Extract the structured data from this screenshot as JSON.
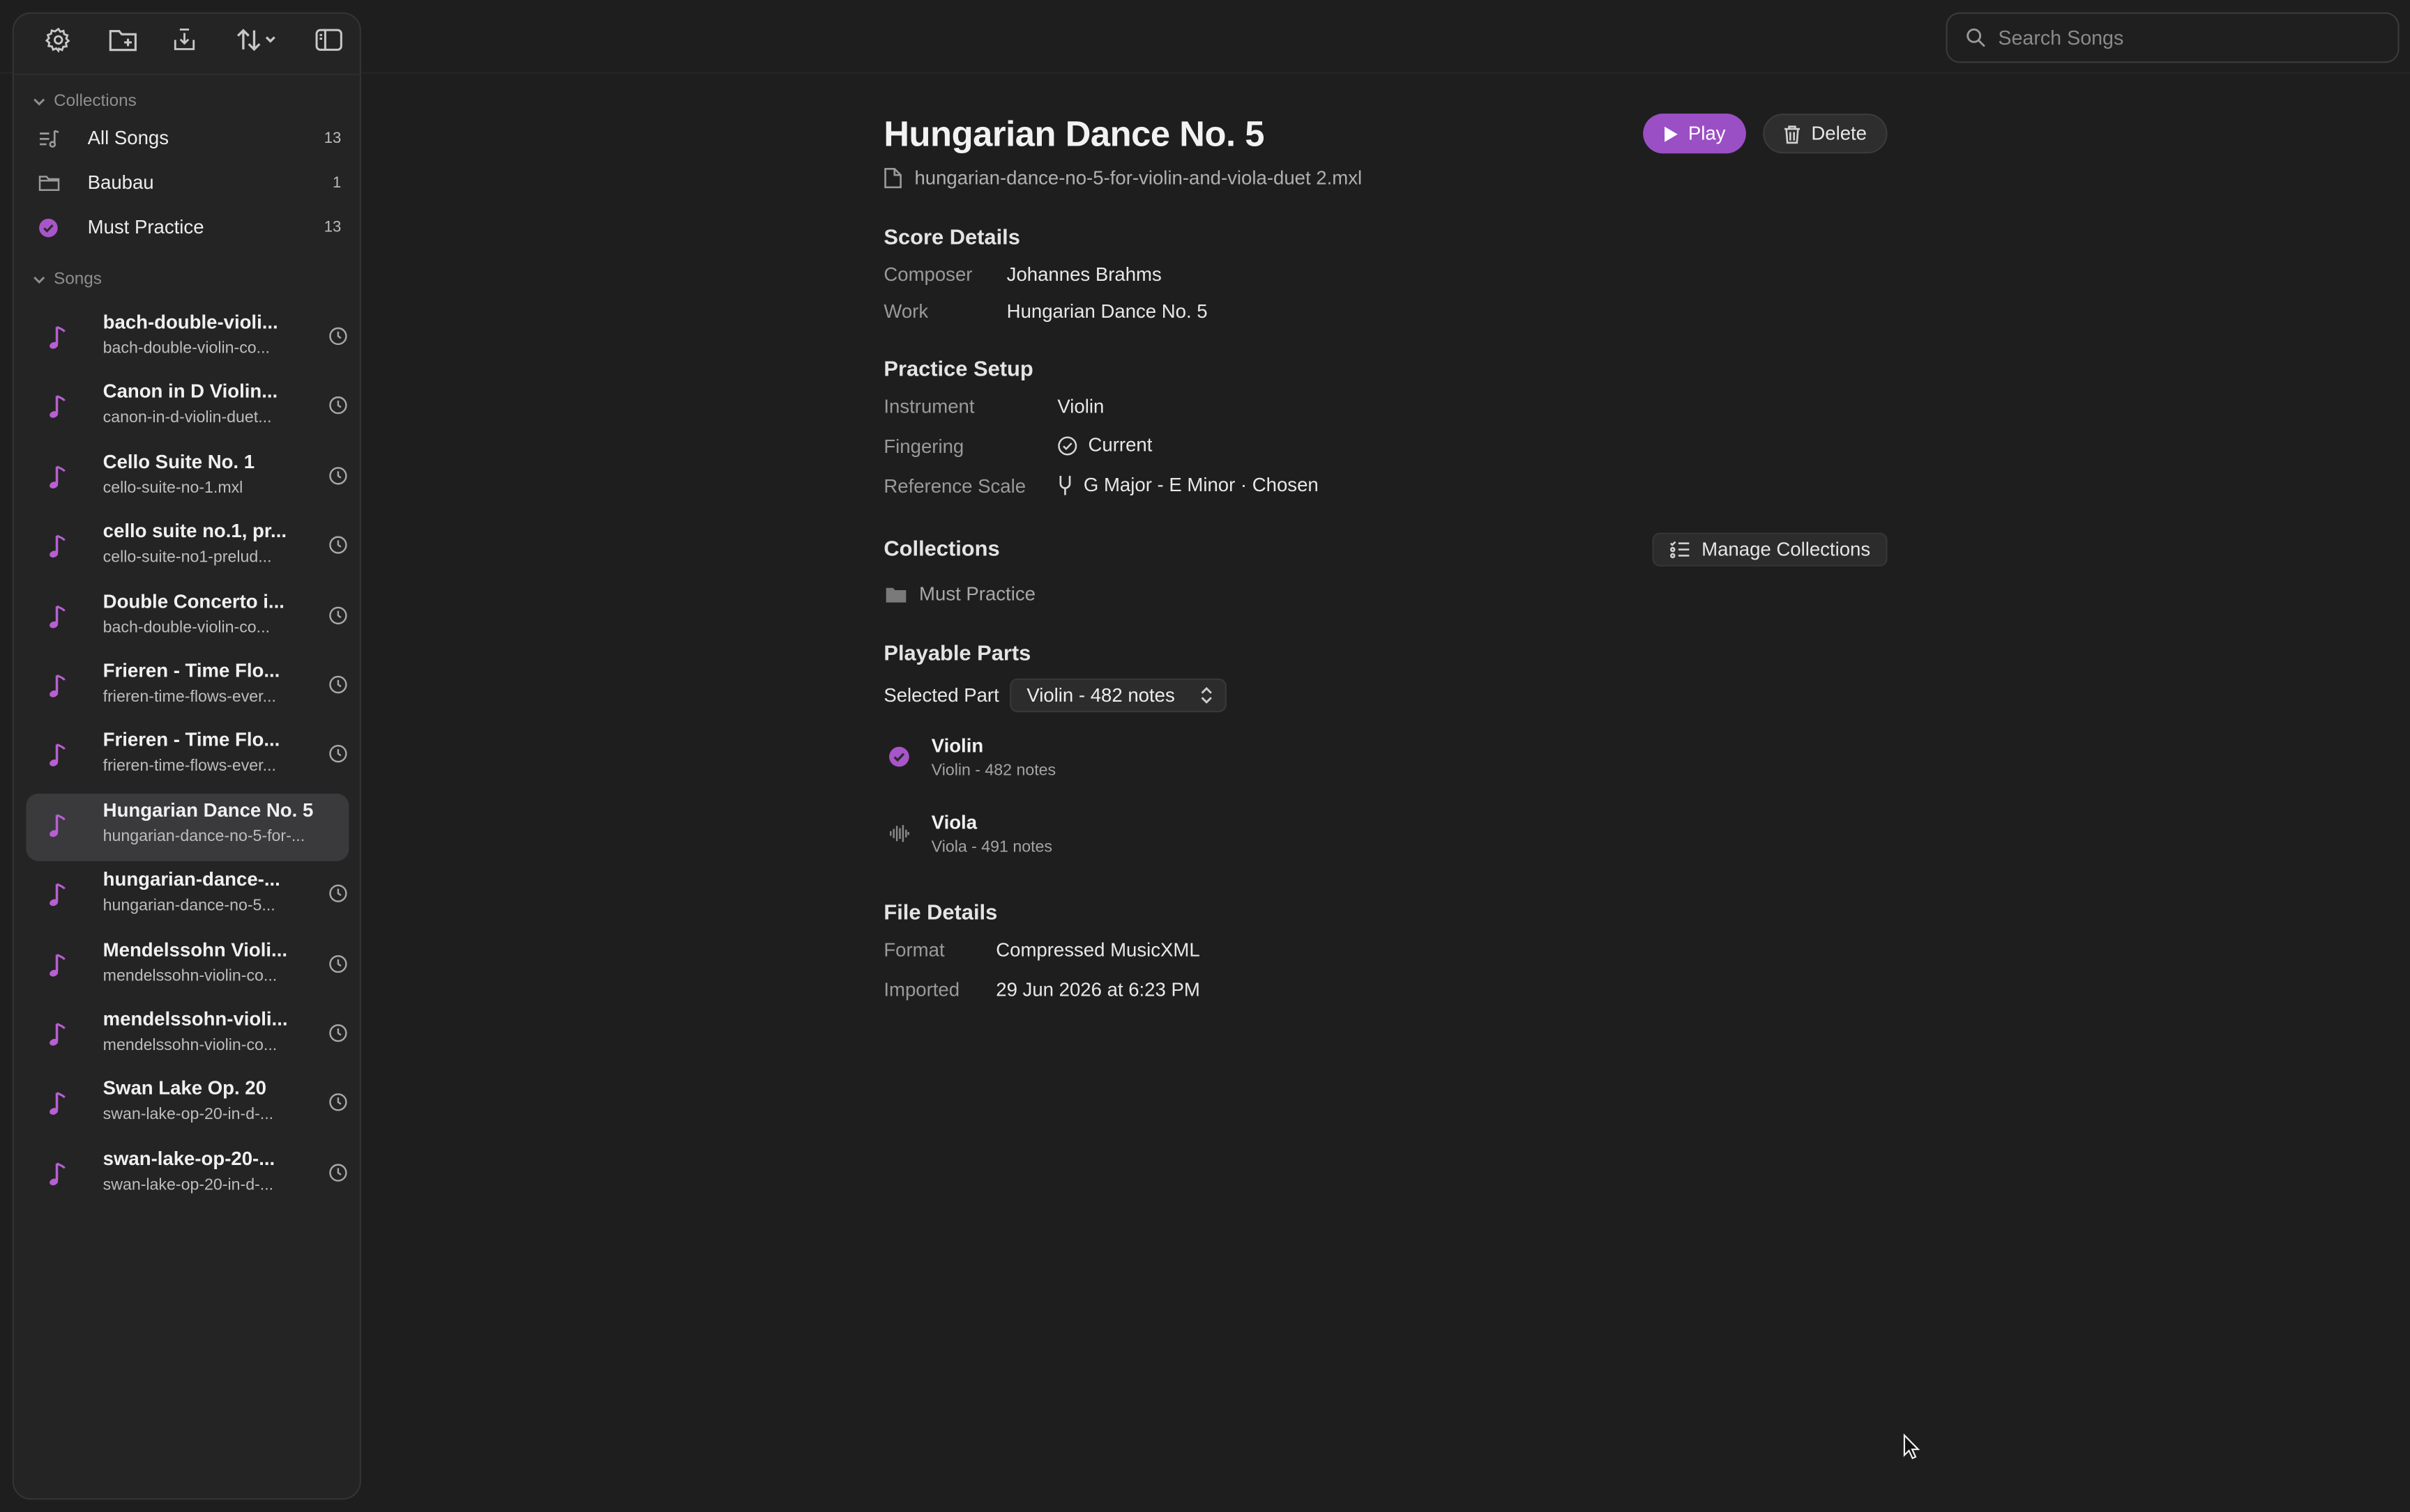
{
  "toolbar": {
    "icons": [
      "gear-icon",
      "new-folder-icon",
      "import-icon",
      "sort-icon",
      "sidebar-toggle-icon"
    ]
  },
  "search": {
    "placeholder": "Search Songs"
  },
  "sidebar": {
    "collections_header": "Collections",
    "collections": [
      {
        "label": "All Songs",
        "count": "13",
        "icon": "music-list-icon"
      },
      {
        "label": "Baubau",
        "count": "1",
        "icon": "folder-icon"
      },
      {
        "label": "Must Practice",
        "count": "13",
        "icon": "check-circle-icon"
      }
    ],
    "songs_header": "Songs",
    "songs": [
      {
        "title": "bach-double-violi...",
        "file": "bach-double-violin-co..."
      },
      {
        "title": "Canon in D Violin...",
        "file": "canon-in-d-violin-duet..."
      },
      {
        "title": "Cello Suite No. 1",
        "file": "cello-suite-no-1.mxl"
      },
      {
        "title": "cello suite no.1, pr...",
        "file": "cello-suite-no1-prelud..."
      },
      {
        "title": "Double Concerto i...",
        "file": "bach-double-violin-co..."
      },
      {
        "title": "Frieren - Time Flo...",
        "file": "frieren-time-flows-ever..."
      },
      {
        "title": "Frieren - Time Flo...",
        "file": "frieren-time-flows-ever..."
      },
      {
        "title": "Hungarian Dance No. 5",
        "file": "hungarian-dance-no-5-for-..."
      },
      {
        "title": "hungarian-dance-...",
        "file": "hungarian-dance-no-5..."
      },
      {
        "title": "Mendelssohn Violi...",
        "file": "mendelssohn-violin-co..."
      },
      {
        "title": "mendelssohn-violi...",
        "file": "mendelssohn-violin-co..."
      },
      {
        "title": "Swan Lake Op. 20",
        "file": "swan-lake-op-20-in-d-..."
      },
      {
        "title": "swan-lake-op-20-...",
        "file": "swan-lake-op-20-in-d-..."
      }
    ],
    "selected_index": 7
  },
  "detail": {
    "title": "Hungarian Dance No. 5",
    "filename": "hungarian-dance-no-5-for-violin-and-viola-duet 2.mxl",
    "play_label": "Play",
    "delete_label": "Delete",
    "score_details": {
      "heading": "Score Details",
      "composer_label": "Composer",
      "composer": "Johannes Brahms",
      "work_label": "Work",
      "work": "Hungarian Dance No. 5"
    },
    "practice_setup": {
      "heading": "Practice Setup",
      "instrument_label": "Instrument",
      "instrument": "Violin",
      "fingering_label": "Fingering",
      "fingering": "Current",
      "scale_label": "Reference Scale",
      "scale": "G Major - E Minor · Chosen"
    },
    "collections": {
      "heading": "Collections",
      "manage_label": "Manage Collections",
      "items": [
        "Must Practice"
      ]
    },
    "parts": {
      "heading": "Playable Parts",
      "selected_label": "Selected Part",
      "selected_value": "Violin - 482 notes",
      "list": [
        {
          "name": "Violin",
          "detail": "Violin - 482 notes",
          "icon": "check-circle-icon"
        },
        {
          "name": "Viola",
          "detail": "Viola - 491 notes",
          "icon": "waveform-icon"
        }
      ]
    },
    "file_details": {
      "heading": "File Details",
      "format_label": "Format",
      "format": "Compressed MusicXML",
      "imported_label": "Imported",
      "imported": "29 Jun 2026 at 6:23 PM"
    }
  },
  "colors": {
    "accent": "#9b4fc4",
    "note_icon": "#b85fd3",
    "background": "#1e1e1e",
    "sidebar": "#242424"
  }
}
